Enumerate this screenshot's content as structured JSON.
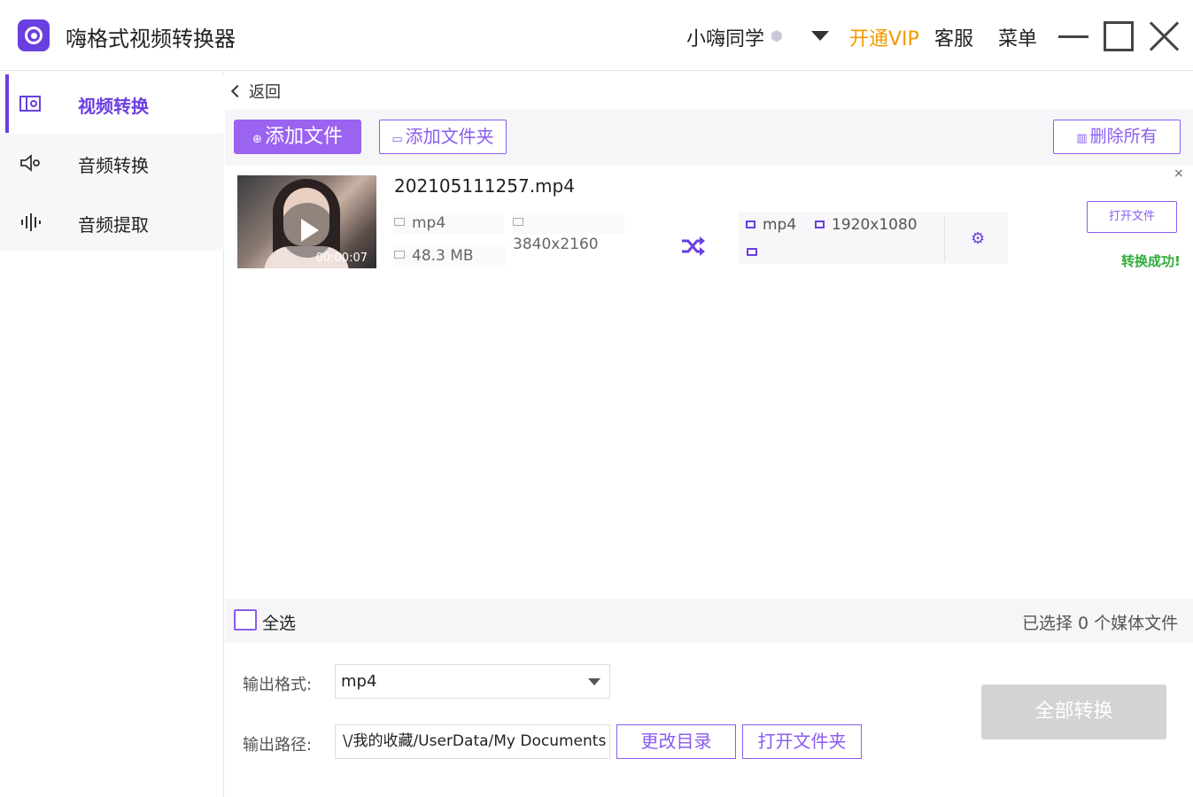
{
  "app": {
    "title": "嗨格式视频转换器",
    "user_name": "小嗨同学",
    "vip_label": "开通VIP",
    "service_label": "客服",
    "menu_label": "菜单",
    "colors": {
      "accent": "#6a3fe0",
      "vip": "#f39a00",
      "success": "#2fae38"
    }
  },
  "sidebar": {
    "items": [
      {
        "label": "视频转换",
        "icon": "video-convert-icon",
        "active": true
      },
      {
        "label": "音频转换",
        "icon": "speaker-icon",
        "active": false
      },
      {
        "label": "音频提取",
        "icon": "waveform-icon",
        "active": false
      }
    ]
  },
  "main": {
    "back_label": "返回",
    "toolbar": {
      "add_file": "添加文件",
      "add_folder": "添加文件夹",
      "delete_all": "删除所有"
    },
    "file": {
      "name": "202105111257.mp4",
      "duration": "00:00:07",
      "src_format": "mp4",
      "src_resolution": "3840x2160",
      "size": "48.3 MB",
      "out_format": "mp4",
      "out_resolution": "1920x1080",
      "open_file_label": "打开文件",
      "status": "转换成功!"
    },
    "select_all_label": "全选",
    "selected_count_text": "已选择 0 个媒体文件",
    "output": {
      "format_label": "输出格式:",
      "format_value": "mp4",
      "path_label": "输出路径:",
      "path_value": "\\/我的收藏/UserData/My Documents",
      "change_dir": "更改目录",
      "open_folder": "打开文件夹",
      "convert_all": "全部转换"
    }
  }
}
